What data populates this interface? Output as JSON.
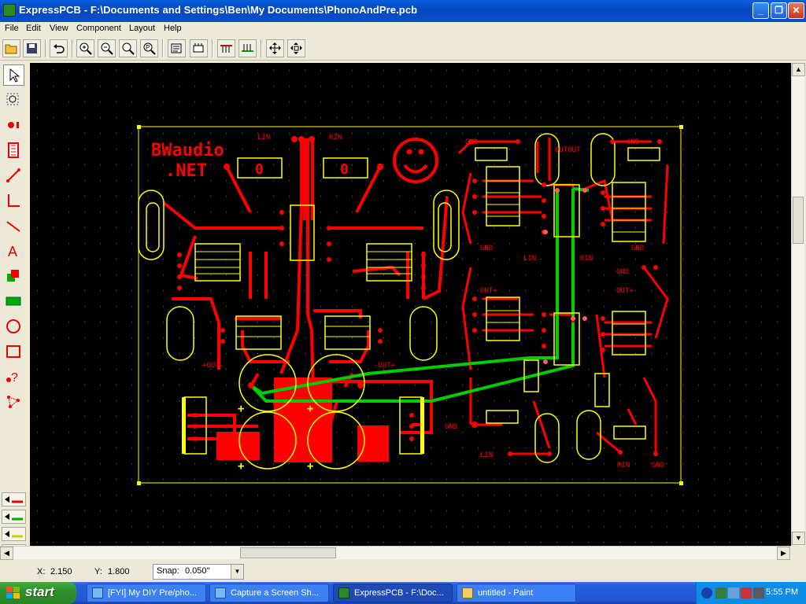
{
  "window": {
    "title": "ExpressPCB - F:\\Documents and Settings\\Ben\\My Documents\\PhonoAndPre.pcb",
    "minimize": "_",
    "maximize": "❐",
    "close": "✕"
  },
  "menu": [
    "File",
    "Edit",
    "View",
    "Component",
    "Layout",
    "Help"
  ],
  "toolbar": {
    "icons": [
      "open-icon",
      "save-icon",
      "undo-icon",
      "zoom-in-icon",
      "zoom-out-icon",
      "zoom-window-icon",
      "zoom-previous-icon",
      "properties-icon",
      "component-manager-icon",
      "top-layer-icon",
      "bottom-layer-icon",
      "move-icon",
      "rotate-icon"
    ]
  },
  "left_tools": [
    "select-arrow-icon",
    "zoom-select-icon",
    "pad-icon",
    "component-icon",
    "trace-icon",
    "corner-trace-icon",
    "straight-trace-icon",
    "text-icon",
    "layer-swap-icon",
    "filled-plane-icon",
    "circle-icon",
    "rectangle-icon",
    "query-icon",
    "netlist-icon"
  ],
  "pcb": {
    "text": {
      "brand1": "BWaudio",
      "brand2": ".NET",
      "lin": "LIN",
      "rin": "RIN",
      "gnd": "GND",
      "outout": "OUTOUT",
      "out_plus": "OUT+",
      "out_plus_left": "+OUT-",
      "out_plus_right": "-OUT+",
      "res_value": "0"
    },
    "colors": {
      "top": "#ff0000",
      "bottom": "#00c000",
      "silk": "#ffff00",
      "grid": "#606060"
    }
  },
  "status": {
    "x_label": "X:",
    "x_value": "2.150",
    "y_label": "Y:",
    "y_value": "1.800",
    "snap_label": "Snap:",
    "snap_value": "0.050\""
  },
  "taskbar": {
    "start": "start",
    "items": [
      {
        "label": "[FYI] My DIY Pre/pho...",
        "icon": "ie-icon"
      },
      {
        "label": "Capture a Screen Sh...",
        "icon": "ie-icon"
      },
      {
        "label": "ExpressPCB - F:\\Doc...",
        "icon": "expresspcb-icon"
      },
      {
        "label": "untitled - Paint",
        "icon": "paint-icon"
      }
    ],
    "clock": "5:55 PM"
  }
}
